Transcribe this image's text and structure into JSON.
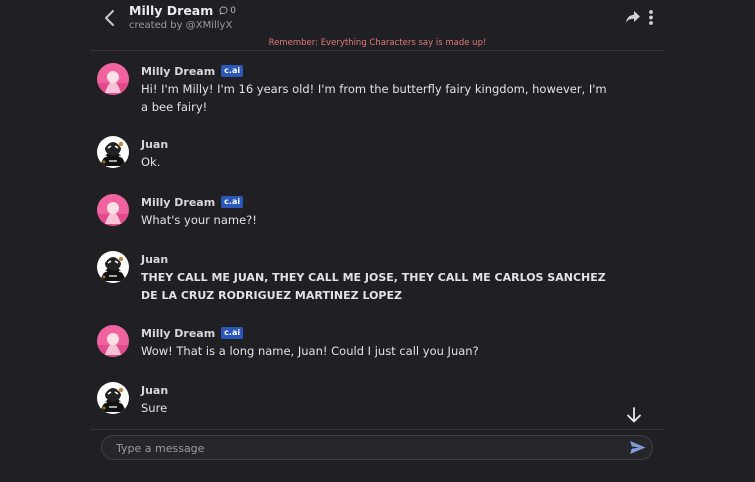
{
  "header": {
    "title": "Milly Dream",
    "chat_count": "0",
    "subtitle": "created by @XMillyX",
    "icons": {
      "back": "chevron-left-icon",
      "share": "share-icon",
      "more": "more-vertical-icon",
      "chat": "chat-bubble-icon"
    }
  },
  "disclaimer": "Remember: Everything Characters say is made up!",
  "messages": [
    {
      "author": "Milly Dream",
      "badge": "c.ai",
      "text": "Hi! I'm Milly! I'm 16 years old! I'm from the butterfly fairy kingdom, however, I'm a bee fairy!",
      "bold": false,
      "avatar": "character-avatar"
    },
    {
      "author": "Juan",
      "badge": "",
      "text": "Ok.",
      "bold": false,
      "avatar": "user-avatar"
    },
    {
      "author": "Milly Dream",
      "badge": "c.ai",
      "text": "What's your name?!",
      "bold": false,
      "avatar": "character-avatar"
    },
    {
      "author": "Juan",
      "badge": "",
      "text": "THEY CALL ME JUAN, THEY CALL ME JOSE, THEY CALL ME CARLOS SANCHEZ DE LA CRUZ RODRIGUEZ MARTINEZ LOPEZ",
      "bold": true,
      "avatar": "user-avatar"
    },
    {
      "author": "Milly Dream",
      "badge": "c.ai",
      "text": "Wow! That is a long name, Juan! Could I just call you Juan?",
      "bold": false,
      "avatar": "character-avatar"
    },
    {
      "author": "Juan",
      "badge": "",
      "text": "Sure",
      "bold": false,
      "avatar": "user-avatar"
    }
  ],
  "composer": {
    "placeholder": "Type a message",
    "value": "",
    "send_icon": "send-icon"
  },
  "scroll_icon": "arrow-down-icon",
  "colors": {
    "background": "#202024",
    "badge": "#2a57b8",
    "disclaimer": "#e0787b",
    "send": "#7f9ed8"
  }
}
